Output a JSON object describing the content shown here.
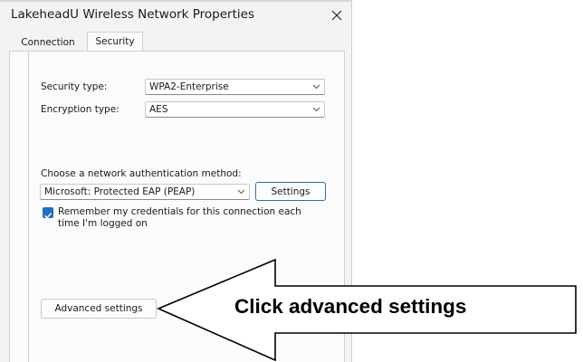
{
  "window": {
    "title": "LakeheadU Wireless Network Properties"
  },
  "tabs": [
    {
      "label": "Connection",
      "active": false
    },
    {
      "label": "Security",
      "active": true
    }
  ],
  "security": {
    "security_type_label": "Security type:",
    "security_type_value": "WPA2-Enterprise",
    "encryption_type_label": "Encryption type:",
    "encryption_type_value": "AES",
    "auth_method_label": "Choose a network authentication method:",
    "auth_method_value": "Microsoft: Protected EAP (PEAP)",
    "settings_button": "Settings",
    "remember_credentials": {
      "line1": "Remember my credentials for this connection each",
      "line2": "time I'm logged on",
      "checked": true
    },
    "advanced_settings_button": "Advanced settings"
  },
  "callout": {
    "text": "Click advanced settings"
  },
  "colors": {
    "accent": "#1f6fc5",
    "dialog_background": "#f3f3f3",
    "panel_background": "#fbfbfb"
  },
  "icons": {
    "close": "close-icon",
    "dropdown": "chevron-down-icon",
    "check": "checkmark-icon"
  }
}
